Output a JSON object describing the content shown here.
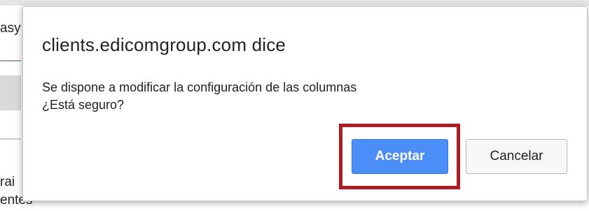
{
  "background": {
    "fragment_top": "asy",
    "fragment_bottom_1": "rai",
    "fragment_bottom_2": "entes"
  },
  "dialog": {
    "title": "clients.edicomgroup.com dice",
    "message_line_1": "Se dispone a modificar la configuración de las columnas",
    "message_line_2": "¿Está seguro?",
    "accept_label": "Aceptar",
    "cancel_label": "Cancelar"
  },
  "colors": {
    "accent_button": "#4c8ef7",
    "highlight_border": "#b01c24"
  }
}
